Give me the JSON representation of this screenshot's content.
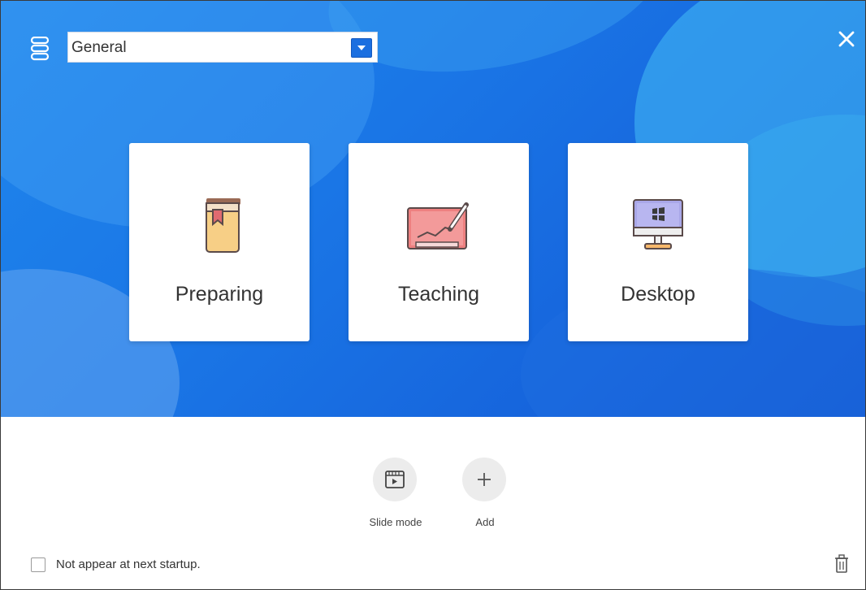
{
  "header": {
    "mode_select": {
      "value": "General"
    }
  },
  "cards": [
    {
      "label": "Preparing",
      "icon": "book-bookmark-icon"
    },
    {
      "label": "Teaching",
      "icon": "whiteboard-pen-icon"
    },
    {
      "label": "Desktop",
      "icon": "windows-monitor-icon"
    }
  ],
  "actions": [
    {
      "label": "Slide mode",
      "icon": "slide-play-icon"
    },
    {
      "label": "Add",
      "icon": "plus-icon"
    }
  ],
  "footer": {
    "startup_checkbox": {
      "label": "Not appear at next startup.",
      "checked": false
    }
  },
  "colors": {
    "hero_blue": "#1a76e6",
    "accent_button": "#1b6fe0",
    "card_bg": "#ffffff",
    "action_circle": "#ececec"
  }
}
